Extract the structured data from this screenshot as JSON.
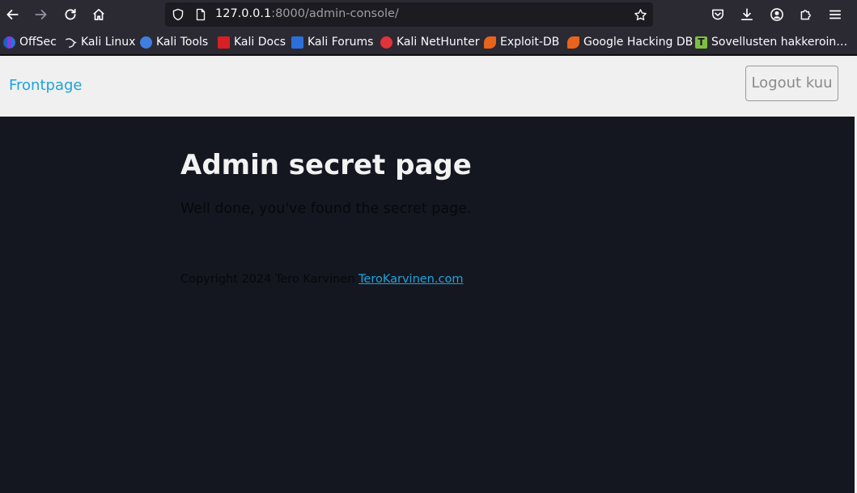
{
  "browser": {
    "url": {
      "host": "127.0.0.1",
      "rest": ":8000/admin-console/"
    },
    "bookmarks": [
      {
        "label": "OffSec",
        "icon": "offsec-icon",
        "color": "#2f6fd6"
      },
      {
        "label": "Kali Linux",
        "icon": "kali-dragon-icon",
        "color": "#e6e6e6"
      },
      {
        "label": "Kali Tools",
        "icon": "kali-tools-icon",
        "color": "#3f7fe0"
      },
      {
        "label": "Kali Docs",
        "icon": "kali-docs-icon",
        "color": "#d91f26"
      },
      {
        "label": "Kali Forums",
        "icon": "kali-forums-icon",
        "color": "#2c6fd9"
      },
      {
        "label": "Kali NetHunter",
        "icon": "kali-nethunter-icon",
        "color": "#e0333a"
      },
      {
        "label": "Exploit-DB",
        "icon": "exploit-db-icon",
        "color": "#e8641c"
      },
      {
        "label": "Google Hacking DB",
        "icon": "ghdb-icon",
        "color": "#e8641c"
      },
      {
        "label": "Sovellusten hakkeroin…",
        "icon": "tero-t-icon",
        "color": "#7cc143"
      }
    ]
  },
  "nav": {
    "frontpage": "Frontpage",
    "logout": "Logout kuu"
  },
  "main": {
    "title": "Admin secret page",
    "lead": "Well done, you've found the secret page."
  },
  "footer": {
    "copyright": "Copyright 2024 Tero Karvinen",
    "link": "TeroKarvinen.com"
  },
  "colors": {
    "page_bg": "#141720",
    "navbar_bg": "#f0f0f0",
    "link": "#1ca4dc"
  }
}
